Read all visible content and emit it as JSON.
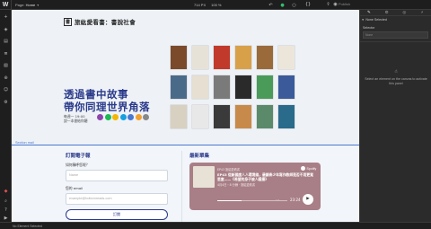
{
  "topbar": {
    "logo": "W",
    "page_prefix": "Page:",
    "page_name": "Home",
    "width_readout": "714 PX",
    "zoom_readout": "100 %",
    "publish_label": "Publish"
  },
  "rail": {
    "icons": [
      "add-icon",
      "navigator-icon",
      "pages-icon",
      "cms-icon",
      "assets-icon",
      "ecommerce-icon",
      "users-icon",
      "logic-icon",
      "settings-icon",
      "audit-icon",
      "search-icon",
      "help-icon",
      "video-icon"
    ]
  },
  "canvas": {
    "brand_mark": "書",
    "brand_name": "旅紘愛看書：書說社會",
    "headline_line1": "透過書中故事",
    "headline_line2": "帶你同理世界角落",
    "schedule_line1": "每週一 19:00",
    "schedule_line2": "說一本書給你聽",
    "platforms": [
      {
        "name": "apple-podcasts-icon",
        "color": "#8e44ad"
      },
      {
        "name": "spotify-icon",
        "color": "#1db954"
      },
      {
        "name": "google-podcasts-icon",
        "color": "#f2b705"
      },
      {
        "name": "kkbox-icon",
        "color": "#16a0e0"
      },
      {
        "name": "soundon-icon",
        "color": "#4a78d0"
      },
      {
        "name": "rss-icon",
        "color": "#f0a030"
      },
      {
        "name": "castbox-icon",
        "color": "#888888"
      }
    ],
    "book_colors": [
      "#7a4a2a",
      "#e7e2d8",
      "#c0392b",
      "#d9a04a",
      "#9a6a3a",
      "#ece6da",
      "#4a6a8a",
      "#e6dfd2",
      "#7a7a7a",
      "#2a2a2a",
      "#4a9a5a",
      "#3a5a9a",
      "#d8d0c0",
      "#e8e8e8",
      "#3a3a3a",
      "#c88a4a",
      "#5a8a6a",
      "#2a6a8a"
    ],
    "section_label": "Section mail",
    "newsletter": {
      "title": "訂閱電子報",
      "name_label": "如何稱呼您呢？",
      "name_placeholder": "Name",
      "email_label": "您的 email",
      "email_placeholder": "example@bottomreads.com",
      "button": "訂閱"
    },
    "latest": {
      "title": "最新單集",
      "episode_series": "EP43 旅紘愛看書",
      "episode_title": "EP43 從新國度人人環境線，最讓青少年寫作教師是否不用更寬思度——《希望的身子被人騷擾》",
      "episode_meta": "4月4日・8 分鐘 · 旅紘愛看書",
      "spotify_label": "Spotify",
      "time": "23:24",
      "progress": 0.35
    }
  },
  "panel": {
    "tabs": [
      "style-brush-icon",
      "settings-gear-icon",
      "interactions-icon",
      "effects-icon"
    ],
    "none_selected": "None Selected",
    "selector_label": "Selector",
    "selector_placeholder": "None",
    "empty_text": "Select an element on the canvas to activate this panel"
  },
  "status": {
    "text": "No Element Selected"
  }
}
